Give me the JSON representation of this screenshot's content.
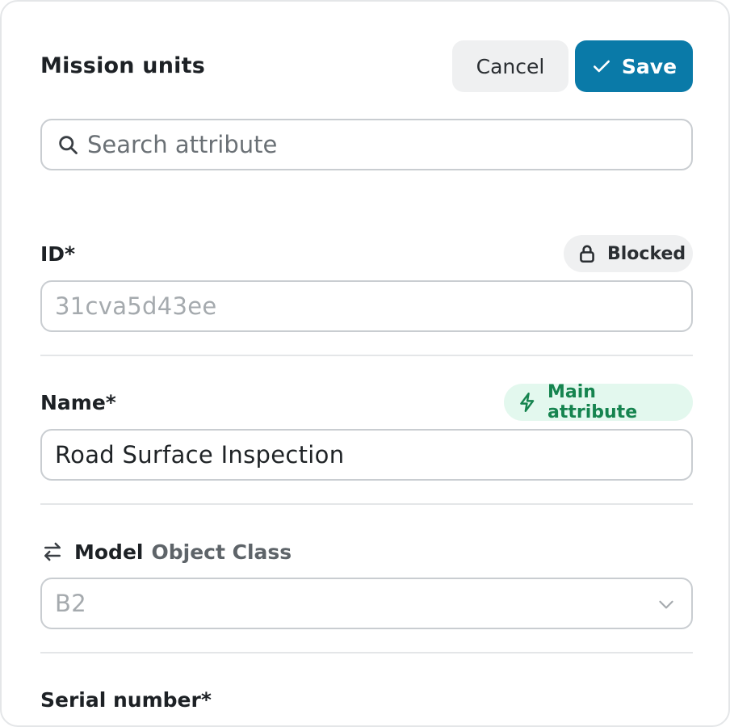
{
  "header": {
    "title": "Mission units",
    "cancel_label": "Cancel",
    "save_label": "Save"
  },
  "search": {
    "placeholder": "Search attribute",
    "value": ""
  },
  "fields": {
    "id": {
      "label": "ID*",
      "badge": "Blocked",
      "value": "31cva5d43ee"
    },
    "name": {
      "label": "Name*",
      "badge": "Main attribute",
      "value": "Road Surface Inspection"
    },
    "model": {
      "label": "Model",
      "sublabel": "Object Class",
      "value": "B2"
    },
    "serial": {
      "label": "Serial number*"
    }
  },
  "icons": {
    "save": "check-icon",
    "search": "search-icon",
    "blocked": "lock-icon",
    "main": "lightning-icon",
    "model": "swap-arrows-icon",
    "select": "chevron-down-icon"
  },
  "colors": {
    "accent": "#0a7aa8",
    "main_badge_bg": "#e3f8ee",
    "main_badge_text": "#16844f",
    "neutral_bg": "#eff0f1"
  }
}
